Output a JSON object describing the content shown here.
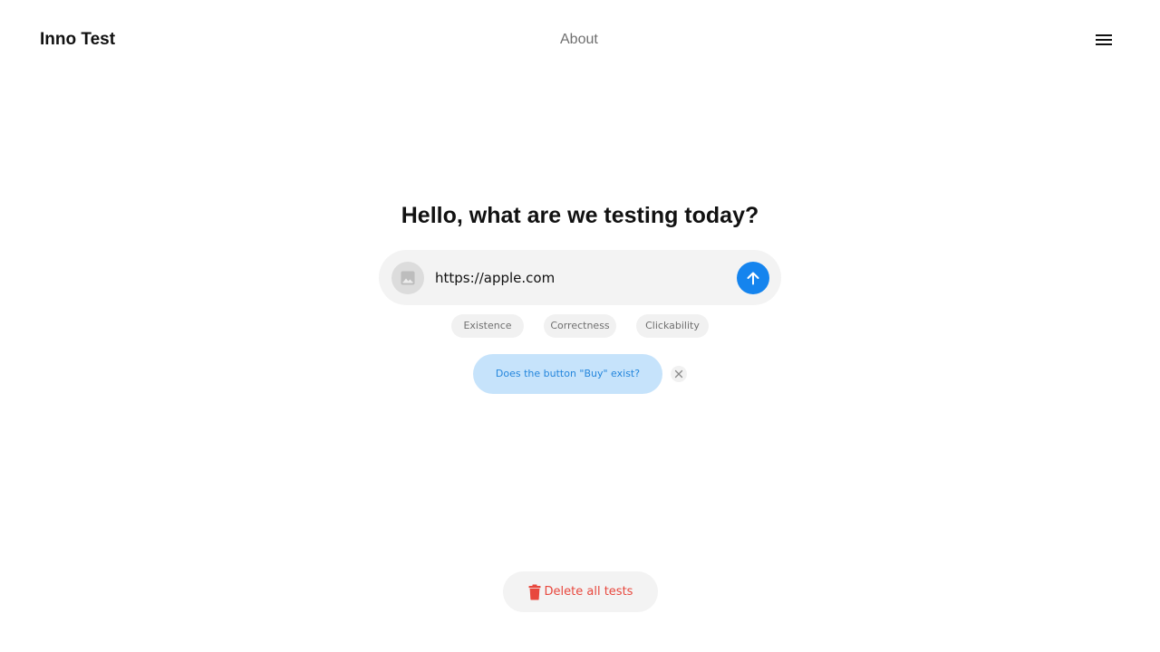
{
  "header": {
    "brand": "Inno Test",
    "nav_about": "About",
    "menu_icon": "hamburger-menu-icon"
  },
  "hero": {
    "title": "Hello, what are we testing today?"
  },
  "input": {
    "value": "https://apple.com",
    "image_icon": "image-icon",
    "send_icon": "arrow-up-icon"
  },
  "chips": [
    "Existence",
    "Correctness",
    "Clickability"
  ],
  "tests": [
    {
      "text": "Does the button \"Buy\" exist?",
      "remove_icon": "close-icon"
    }
  ],
  "footer": {
    "delete_label": "Delete all tests",
    "delete_icon": "trash-icon"
  },
  "colors": {
    "accent": "#1584ee",
    "bubble_bg": "#c6e3fb",
    "bubble_text": "#2486dc",
    "danger": "#e8473d",
    "surface": "#f3f3f3"
  }
}
